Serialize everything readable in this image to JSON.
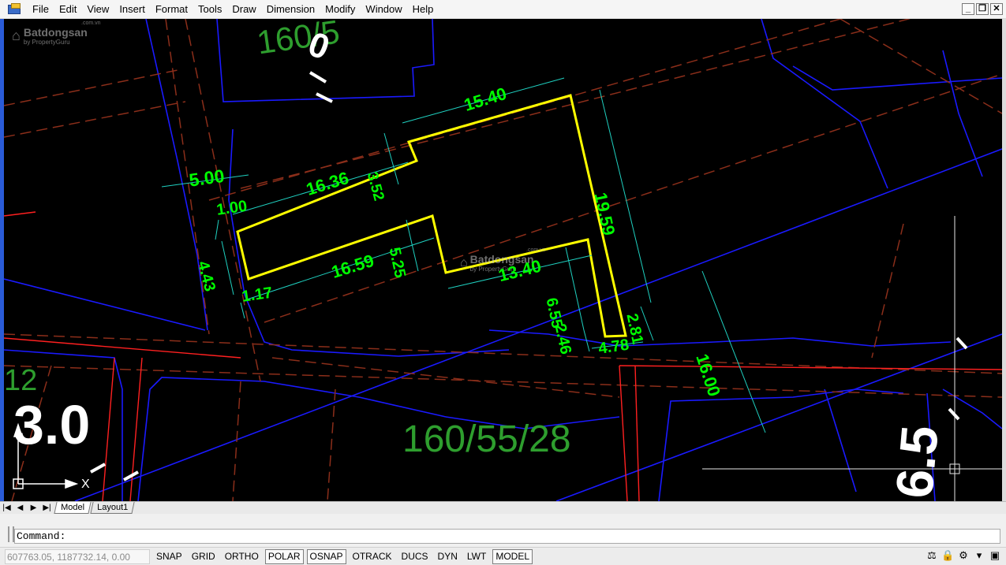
{
  "menu": {
    "items": [
      "File",
      "Edit",
      "View",
      "Insert",
      "Format",
      "Tools",
      "Draw",
      "Dimension",
      "Modify",
      "Window",
      "Help"
    ]
  },
  "window_controls": {
    "minimize": "_",
    "restore": "❐",
    "close": "✕"
  },
  "watermark": {
    "brand": "Batdongsan",
    "tagline": "by PropertyGuru",
    "domain": ".com.vn"
  },
  "drawing": {
    "dimensions": [
      "15.40",
      "5.00",
      "16.36",
      "3.52",
      "19.59",
      "1.00",
      "4.43",
      "16.59",
      "5.25",
      "13.40",
      "6.55",
      "2.46",
      "2.81",
      "1.17",
      "4.78",
      "16.00"
    ],
    "labels": {
      "top_parcel": "160/5",
      "top_number": "0",
      "bottom_parcel": "160/55/28",
      "left_number": "3.0",
      "left_small": "12",
      "right_number": "6.5"
    },
    "ucs_x_label": "X",
    "colors": {
      "background": "#000000",
      "parcel_outline": "#ffff00",
      "dimension": "#00ff00",
      "road_lines": "#1a1aff",
      "boundary_dashed": "#8b2e1a",
      "red_lines": "#ff2020",
      "labels": "#2e9e2e"
    }
  },
  "layout_tabs": {
    "nav": [
      "|◀",
      "◀",
      "▶",
      "▶|"
    ],
    "tabs": [
      "Model",
      "Layout1"
    ]
  },
  "command": {
    "prompt": "Command:"
  },
  "status": {
    "coordinates": "607763.05, 1187732.14, 0.00",
    "toggles": [
      {
        "label": "SNAP",
        "on": false
      },
      {
        "label": "GRID",
        "on": false
      },
      {
        "label": "ORTHO",
        "on": false
      },
      {
        "label": "POLAR",
        "on": true
      },
      {
        "label": "OSNAP",
        "on": true
      },
      {
        "label": "OTRACK",
        "on": false
      },
      {
        "label": "DUCS",
        "on": false
      },
      {
        "label": "DYN",
        "on": false
      },
      {
        "label": "LWT",
        "on": false
      },
      {
        "label": "MODEL",
        "on": true
      }
    ]
  }
}
